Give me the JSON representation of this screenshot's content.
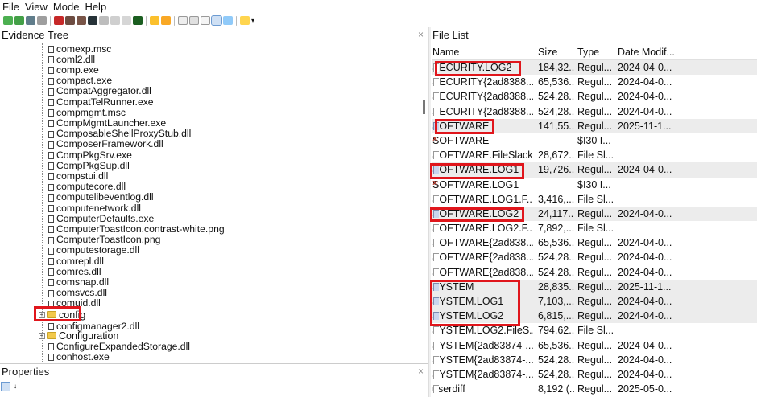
{
  "menu": [
    "File",
    "View",
    "Mode",
    "Help"
  ],
  "panels": {
    "evidence_tree": "Evidence Tree",
    "file_list": "File List",
    "properties": "Properties",
    "close_glyph": "×"
  },
  "tree_items": [
    "comexp.msc",
    "coml2.dll",
    "comp.exe",
    "compact.exe",
    "CompatAggregator.dll",
    "CompatTelRunner.exe",
    "compmgmt.msc",
    "CompMgmtLauncher.exe",
    "ComposableShellProxyStub.dll",
    "ComposerFramework.dll",
    "CompPkgSrv.exe",
    "CompPkgSup.dll",
    "compstui.dll",
    "computecore.dll",
    "computelibeventlog.dll",
    "computenetwork.dll",
    "ComputerDefaults.exe",
    "ComputerToastIcon.contrast-white.png",
    "ComputerToastIcon.png",
    "computestorage.dll",
    "comrepl.dll",
    "comres.dll",
    "comsnap.dll",
    "comsvcs.dll",
    "comuid.dll"
  ],
  "tree_after": [
    {
      "label": "config",
      "type": "folder"
    },
    {
      "label": "configmanager2.dll",
      "type": "file"
    },
    {
      "label": "Configuration",
      "type": "folder"
    },
    {
      "label": "ConfigureExpandedStorage.dll",
      "type": "file"
    },
    {
      "label": "conhost.exe",
      "type": "file"
    }
  ],
  "file_list": {
    "columns": [
      "Name",
      "Size",
      "Type",
      "Date Modif..."
    ],
    "rows": [
      {
        "name": "SECURITY.LOG2",
        "size": "184,32...",
        "type": "Regul...",
        "date": "2024-04-0...",
        "icon": "doc",
        "sel": true
      },
      {
        "name": "SECURITY{2ad8388...",
        "size": "65,536...",
        "type": "Regul...",
        "date": "2024-04-0...",
        "icon": "doc"
      },
      {
        "name": "SECURITY{2ad8388...",
        "size": "524,28...",
        "type": "Regul...",
        "date": "2024-04-0...",
        "icon": "doc"
      },
      {
        "name": "SECURITY{2ad8388...",
        "size": "524,28...",
        "type": "Regul...",
        "date": "2024-04-0...",
        "icon": "doc"
      },
      {
        "name": "SOFTWARE",
        "size": "141,55...",
        "type": "Regul...",
        "date": "2025-11-1...",
        "icon": "reg",
        "sel": true
      },
      {
        "name": "SOFTWARE",
        "size": "",
        "type": "$I30 I...",
        "date": "",
        "icon": "del"
      },
      {
        "name": "SOFTWARE.FileSlack",
        "size": "28,672...",
        "type": "File Sl...",
        "date": "",
        "icon": "doc"
      },
      {
        "name": "SOFTWARE.LOG1",
        "size": "19,726...",
        "type": "Regul...",
        "date": "2024-04-0...",
        "icon": "reg",
        "sel": true
      },
      {
        "name": "SOFTWARE.LOG1",
        "size": "",
        "type": "$I30 I...",
        "date": "",
        "icon": "del"
      },
      {
        "name": "SOFTWARE.LOG1.F...",
        "size": "3,416,...",
        "type": "File Sl...",
        "date": "",
        "icon": "doc"
      },
      {
        "name": "SOFTWARE.LOG2",
        "size": "24,117...",
        "type": "Regul...",
        "date": "2024-04-0...",
        "icon": "reg",
        "sel": true
      },
      {
        "name": "SOFTWARE.LOG2.F...",
        "size": "7,892,...",
        "type": "File Sl...",
        "date": "",
        "icon": "doc"
      },
      {
        "name": "SOFTWARE{2ad838...",
        "size": "65,536...",
        "type": "Regul...",
        "date": "2024-04-0...",
        "icon": "doc"
      },
      {
        "name": "SOFTWARE{2ad838...",
        "size": "524,28...",
        "type": "Regul...",
        "date": "2024-04-0...",
        "icon": "doc"
      },
      {
        "name": "SOFTWARE{2ad838...",
        "size": "524,28...",
        "type": "Regul...",
        "date": "2024-04-0...",
        "icon": "doc"
      },
      {
        "name": "SYSTEM",
        "size": "28,835...",
        "type": "Regul...",
        "date": "2025-11-1...",
        "icon": "reg",
        "sel": true
      },
      {
        "name": "SYSTEM.LOG1",
        "size": "7,103,...",
        "type": "Regul...",
        "date": "2024-04-0...",
        "icon": "reg",
        "sel": true
      },
      {
        "name": "SYSTEM.LOG2",
        "size": "6,815,...",
        "type": "Regul...",
        "date": "2024-04-0...",
        "icon": "reg",
        "sel": true
      },
      {
        "name": "SYSTEM.LOG2.FileS...",
        "size": "794,62...",
        "type": "File Sl...",
        "date": "",
        "icon": "doc"
      },
      {
        "name": "SYSTEM{2ad83874-...",
        "size": "65,536...",
        "type": "Regul...",
        "date": "2024-04-0...",
        "icon": "doc"
      },
      {
        "name": "SYSTEM{2ad83874-...",
        "size": "524,28...",
        "type": "Regul...",
        "date": "2024-04-0...",
        "icon": "doc"
      },
      {
        "name": "SYSTEM{2ad83874-...",
        "size": "524,28...",
        "type": "Regul...",
        "date": "2024-04-0...",
        "icon": "doc"
      },
      {
        "name": "userdiff",
        "size": "8,192 (...",
        "type": "Regul...",
        "date": "2025-05-0...",
        "icon": "doc"
      }
    ]
  },
  "highlight_color": "#e0161c"
}
